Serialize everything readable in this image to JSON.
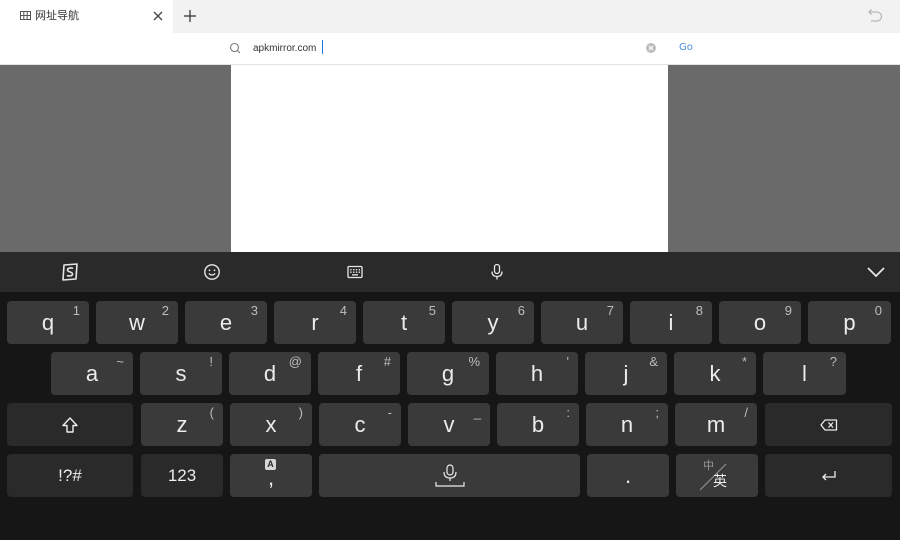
{
  "tab": {
    "title": "网址导航"
  },
  "address": {
    "value": "apkmirror.com",
    "go_label": "Go"
  },
  "keyboard": {
    "rows": [
      [
        {
          "main": "q",
          "sub": "1"
        },
        {
          "main": "w",
          "sub": "2"
        },
        {
          "main": "e",
          "sub": "3"
        },
        {
          "main": "r",
          "sub": "4"
        },
        {
          "main": "t",
          "sub": "5"
        },
        {
          "main": "y",
          "sub": "6"
        },
        {
          "main": "u",
          "sub": "7"
        },
        {
          "main": "i",
          "sub": "8"
        },
        {
          "main": "o",
          "sub": "9"
        },
        {
          "main": "p",
          "sub": "0"
        }
      ],
      [
        {
          "main": "a",
          "sub": "~"
        },
        {
          "main": "s",
          "sub": "!"
        },
        {
          "main": "d",
          "sub": "@"
        },
        {
          "main": "f",
          "sub": "#"
        },
        {
          "main": "g",
          "sub": "%"
        },
        {
          "main": "h",
          "sub": "'"
        },
        {
          "main": "j",
          "sub": "&"
        },
        {
          "main": "k",
          "sub": "*"
        },
        {
          "main": "l",
          "sub": "?"
        }
      ],
      [
        {
          "main": "z",
          "sub": "("
        },
        {
          "main": "x",
          "sub": ")"
        },
        {
          "main": "c",
          "sub": "-"
        },
        {
          "main": "v",
          "sub": "_"
        },
        {
          "main": "b",
          "sub": ":"
        },
        {
          "main": "n",
          "sub": ";"
        },
        {
          "main": "m",
          "sub": "/"
        }
      ]
    ],
    "symbols_label": "!?#",
    "numbers_label": "123",
    "comma_label": ",",
    "comma_badge": "A",
    "period_label": ".",
    "lang_top": "中",
    "lang_bottom": "英"
  }
}
